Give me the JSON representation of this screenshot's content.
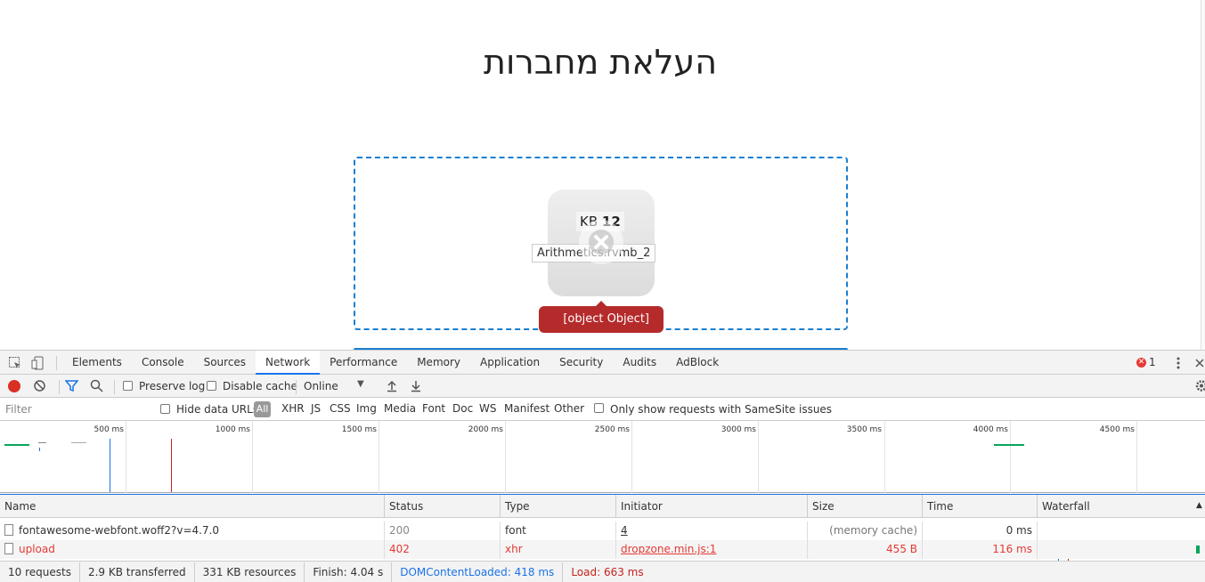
{
  "page": {
    "title": "העלאת מחברות",
    "dropzone": {
      "file_size_num": "12",
      "file_size_unit": "KB",
      "file_name": "Arithmetics.rvmb_2",
      "error_message": "[object Object]"
    }
  },
  "devtools": {
    "tabs": [
      "Elements",
      "Console",
      "Sources",
      "Network",
      "Performance",
      "Memory",
      "Application",
      "Security",
      "Audits",
      "AdBlock"
    ],
    "active_tab": "Network",
    "error_count": "1",
    "toolbar": {
      "preserve_log": "Preserve log",
      "disable_cache": "Disable cache",
      "throttling": "Online"
    },
    "filter": {
      "placeholder": "Filter",
      "hide_data_urls": "Hide data URLs",
      "all": "All",
      "types": [
        "XHR",
        "JS",
        "CSS",
        "Img",
        "Media",
        "Font",
        "Doc",
        "WS",
        "Manifest",
        "Other"
      ],
      "samesite": "Only show requests with SameSite issues"
    },
    "overview_ticks": [
      "500 ms",
      "1000 ms",
      "1500 ms",
      "2000 ms",
      "2500 ms",
      "3000 ms",
      "3500 ms",
      "4000 ms",
      "4500 ms"
    ],
    "columns": {
      "name": "Name",
      "status": "Status",
      "type": "Type",
      "initiator": "Initiator",
      "size": "Size",
      "time": "Time",
      "waterfall": "Waterfall"
    },
    "requests": [
      {
        "name": "fontawesome-webfont.woff2?v=4.7.0",
        "status": "200",
        "type": "font",
        "initiator": "4",
        "size": "(memory cache)",
        "time": "0 ms"
      },
      {
        "name": "upload",
        "status": "402",
        "type": "xhr",
        "initiator": "dropzone.min.js:1",
        "size": "455 B",
        "time": "116 ms"
      }
    ],
    "summary": {
      "requests": "10 requests",
      "transferred": "2.9 KB transferred",
      "resources": "331 KB resources",
      "finish": "Finish: 4.04 s",
      "dom_content_loaded": "DOMContentLoaded: 418 ms",
      "load": "Load: 663 ms"
    },
    "colors": {
      "dcl": "#1a73e8",
      "load": "#c5221f",
      "error": "#e53935"
    }
  }
}
